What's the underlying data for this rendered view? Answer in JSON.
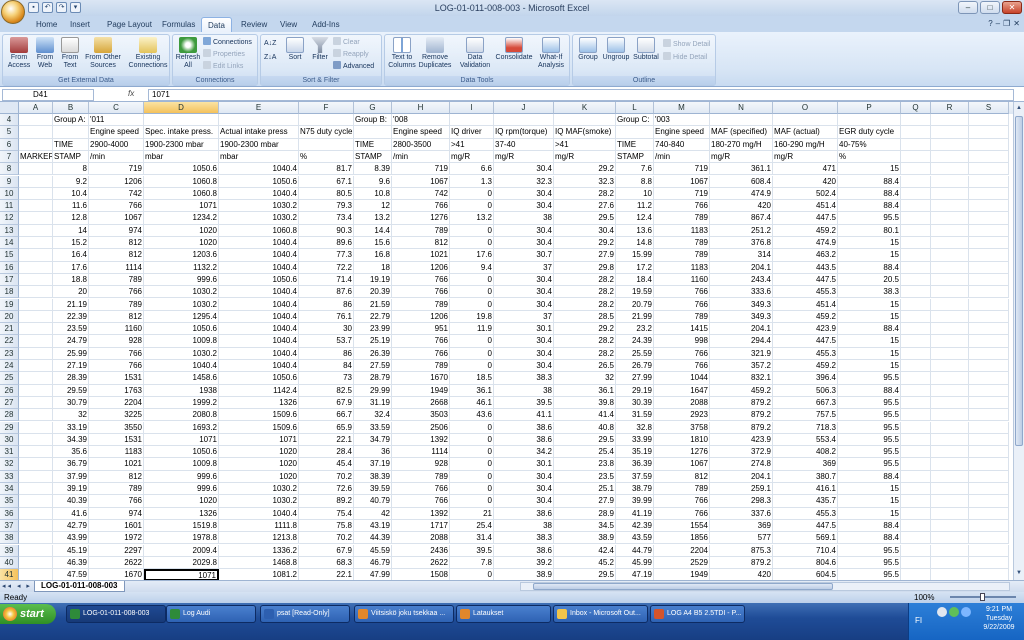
{
  "window": {
    "title": "LOG-01-011-008-003 - Microsoft Excel",
    "minimize": "–",
    "maximize": "□",
    "close": "✕"
  },
  "qat": {
    "save": "▪",
    "undo": "↶",
    "redo": "↷",
    "more": "▾"
  },
  "menu_tabs": [
    "Home",
    "Insert",
    "Page Layout",
    "Formulas",
    "Data",
    "Review",
    "View",
    "Add-Ins"
  ],
  "active_tab": "Data",
  "workbook_controls": {
    "help": "?",
    "minimize": "–",
    "restore": "❐",
    "close": "✕"
  },
  "ribbon": {
    "external": {
      "label": "Get External Data",
      "from_access": "From Access",
      "from_web": "From Web",
      "from_text": "From Text",
      "from_other": "From Other Sources",
      "existing": "Existing Connections"
    },
    "connections": {
      "label": "Connections",
      "refresh": "Refresh All",
      "connections": "Connections",
      "properties": "Properties",
      "edit_links": "Edit Links"
    },
    "sort": {
      "label": "Sort & Filter",
      "az": "A↓Z",
      "za": "Z↓A",
      "sort": "Sort",
      "filter": "Filter",
      "clear": "Clear",
      "reapply": "Reapply",
      "advanced": "Advanced"
    },
    "tools": {
      "label": "Data Tools",
      "text_to_columns": "Text to Columns",
      "remove_duplicates": "Remove Duplicates",
      "validation": "Data Validation",
      "consolidate": "Consolidate",
      "what_if": "What-If Analysis"
    },
    "outline": {
      "label": "Outline",
      "group": "Group",
      "ungroup": "Ungroup",
      "subtotal": "Subtotal",
      "show_detail": "Show Detail",
      "hide_detail": "Hide Detail"
    }
  },
  "formula_bar": {
    "name_box": "D41",
    "fx": "fx",
    "value": "1071"
  },
  "columns": [
    "A",
    "B",
    "C",
    "D",
    "E",
    "F",
    "G",
    "H",
    "I",
    "J",
    "K",
    "L",
    "M",
    "N",
    "O",
    "P",
    "Q",
    "R",
    "S"
  ],
  "rows": [
    {
      "n": "4",
      "c": [
        "",
        "Group A:",
        "'011",
        "",
        "",
        "",
        "Group B:",
        "'008",
        "",
        "",
        "",
        "Group C:",
        "'003",
        "",
        "",
        "",
        "",
        "",
        ""
      ]
    },
    {
      "n": "5",
      "c": [
        "",
        "",
        "Engine speed",
        "Spec. intake press.",
        "Actual intake press",
        "N75 duty cycle",
        "",
        "Engine speed",
        "IQ driver",
        "IQ rpm(torque)",
        "IQ MAF(smoke)",
        "",
        "Engine speed",
        "MAF (specified)",
        "MAF (actual)",
        "EGR duty cycle",
        "",
        "",
        ""
      ]
    },
    {
      "n": "6",
      "c": [
        "",
        "TIME",
        "2900-4000",
        "1900-2300 mbar",
        "1900-2300 mbar",
        "",
        "TIME",
        "2800-3500",
        ">41",
        "37-40",
        ">41",
        "TIME",
        "740-840",
        "180-270 mg/H",
        "160-290 mg/H",
        "40-75%",
        "",
        "",
        ""
      ]
    },
    {
      "n": "7",
      "c": [
        "MARKER",
        "STAMP",
        "/min",
        "mbar",
        "mbar",
        "%",
        "STAMP",
        "/min",
        "mg/R",
        "mg/R",
        "mg/R",
        "STAMP",
        "/min",
        "mg/R",
        "mg/R",
        "%",
        "",
        "",
        ""
      ]
    },
    {
      "n": "8",
      "c": [
        "",
        "8",
        "719",
        "1050.6",
        "1040.4",
        "81.7",
        "8.39",
        "719",
        "6.6",
        "30.4",
        "29.2",
        "7.6",
        "719",
        "361.1",
        "471",
        "15",
        "",
        "",
        ""
      ]
    },
    {
      "n": "9",
      "c": [
        "",
        "9.2",
        "1206",
        "1060.8",
        "1050.6",
        "67.1",
        "9.6",
        "1067",
        "1.3",
        "32.3",
        "32.3",
        "8.8",
        "1067",
        "608.4",
        "420",
        "88.4",
        "",
        "",
        ""
      ]
    },
    {
      "n": "10",
      "c": [
        "",
        "10.4",
        "742",
        "1060.8",
        "1040.4",
        "80.5",
        "10.8",
        "742",
        "0",
        "30.4",
        "28.2",
        "10",
        "719",
        "474.9",
        "502.4",
        "88.4",
        "",
        "",
        ""
      ]
    },
    {
      "n": "11",
      "c": [
        "",
        "11.6",
        "766",
        "1071",
        "1030.2",
        "79.3",
        "12",
        "766",
        "0",
        "30.4",
        "27.6",
        "11.2",
        "766",
        "420",
        "451.4",
        "88.4",
        "",
        "",
        ""
      ]
    },
    {
      "n": "12",
      "c": [
        "",
        "12.8",
        "1067",
        "1234.2",
        "1030.2",
        "73.4",
        "13.2",
        "1276",
        "13.2",
        "38",
        "29.5",
        "12.4",
        "789",
        "867.4",
        "447.5",
        "95.5",
        "",
        "",
        ""
      ]
    },
    {
      "n": "13",
      "c": [
        "",
        "14",
        "974",
        "1020",
        "1060.8",
        "90.3",
        "14.4",
        "789",
        "0",
        "30.4",
        "30.4",
        "13.6",
        "1183",
        "251.2",
        "459.2",
        "80.1",
        "",
        "",
        ""
      ]
    },
    {
      "n": "14",
      "c": [
        "",
        "15.2",
        "812",
        "1020",
        "1040.4",
        "89.6",
        "15.6",
        "812",
        "0",
        "30.4",
        "29.2",
        "14.8",
        "789",
        "376.8",
        "474.9",
        "15",
        "",
        "",
        ""
      ]
    },
    {
      "n": "15",
      "c": [
        "",
        "16.4",
        "812",
        "1203.6",
        "1040.4",
        "77.3",
        "16.8",
        "1021",
        "17.6",
        "30.7",
        "27.9",
        "15.99",
        "789",
        "314",
        "463.2",
        "15",
        "",
        "",
        ""
      ]
    },
    {
      "n": "16",
      "c": [
        "",
        "17.6",
        "1114",
        "1132.2",
        "1040.4",
        "72.2",
        "18",
        "1206",
        "9.4",
        "37",
        "29.8",
        "17.2",
        "1183",
        "204.1",
        "443.5",
        "88.4",
        "",
        "",
        ""
      ]
    },
    {
      "n": "17",
      "c": [
        "",
        "18.8",
        "789",
        "999.6",
        "1050.6",
        "71.4",
        "19.19",
        "766",
        "0",
        "30.4",
        "28.2",
        "18.4",
        "1160",
        "243.4",
        "447.5",
        "20.5",
        "",
        "",
        ""
      ]
    },
    {
      "n": "18",
      "c": [
        "",
        "20",
        "766",
        "1030.2",
        "1040.4",
        "87.6",
        "20.39",
        "766",
        "0",
        "30.4",
        "28.2",
        "19.59",
        "766",
        "333.6",
        "455.3",
        "38.3",
        "",
        "",
        ""
      ]
    },
    {
      "n": "19",
      "c": [
        "",
        "21.19",
        "789",
        "1030.2",
        "1040.4",
        "86",
        "21.59",
        "789",
        "0",
        "30.4",
        "28.2",
        "20.79",
        "766",
        "349.3",
        "451.4",
        "15",
        "",
        "",
        ""
      ]
    },
    {
      "n": "20",
      "c": [
        "",
        "22.39",
        "812",
        "1295.4",
        "1040.4",
        "76.1",
        "22.79",
        "1206",
        "19.8",
        "37",
        "28.5",
        "21.99",
        "789",
        "349.3",
        "459.2",
        "15",
        "",
        "",
        ""
      ]
    },
    {
      "n": "21",
      "c": [
        "",
        "23.59",
        "1160",
        "1050.6",
        "1040.4",
        "30",
        "23.99",
        "951",
        "11.9",
        "30.1",
        "29.2",
        "23.2",
        "1415",
        "204.1",
        "423.9",
        "88.4",
        "",
        "",
        ""
      ]
    },
    {
      "n": "22",
      "c": [
        "",
        "24.79",
        "928",
        "1009.8",
        "1040.4",
        "53.7",
        "25.19",
        "766",
        "0",
        "30.4",
        "28.2",
        "24.39",
        "998",
        "294.4",
        "447.5",
        "15",
        "",
        "",
        ""
      ]
    },
    {
      "n": "23",
      "c": [
        "",
        "25.99",
        "766",
        "1030.2",
        "1040.4",
        "86",
        "26.39",
        "766",
        "0",
        "30.4",
        "28.2",
        "25.59",
        "766",
        "321.9",
        "455.3",
        "15",
        "",
        "",
        ""
      ]
    },
    {
      "n": "24",
      "c": [
        "",
        "27.19",
        "766",
        "1040.4",
        "1040.4",
        "84",
        "27.59",
        "789",
        "0",
        "30.4",
        "26.5",
        "26.79",
        "766",
        "357.2",
        "459.2",
        "15",
        "",
        "",
        ""
      ]
    },
    {
      "n": "25",
      "c": [
        "",
        "28.39",
        "1531",
        "1458.6",
        "1050.6",
        "73",
        "28.79",
        "1670",
        "18.5",
        "38.3",
        "32",
        "27.99",
        "1044",
        "832.1",
        "396.4",
        "95.5",
        "",
        "",
        ""
      ]
    },
    {
      "n": "26",
      "c": [
        "",
        "29.59",
        "1763",
        "1938",
        "1142.4",
        "82.5",
        "29.99",
        "1949",
        "36.1",
        "38",
        "36.1",
        "29.19",
        "1647",
        "459.2",
        "506.3",
        "88.4",
        "",
        "",
        ""
      ]
    },
    {
      "n": "27",
      "c": [
        "",
        "30.79",
        "2204",
        "1999.2",
        "1326",
        "67.9",
        "31.19",
        "2668",
        "46.1",
        "39.5",
        "39.8",
        "30.39",
        "2088",
        "879.2",
        "667.3",
        "95.5",
        "",
        "",
        ""
      ]
    },
    {
      "n": "28",
      "c": [
        "",
        "32",
        "3225",
        "2080.8",
        "1509.6",
        "66.7",
        "32.4",
        "3503",
        "43.6",
        "41.1",
        "41.4",
        "31.59",
        "2923",
        "879.2",
        "757.5",
        "95.5",
        "",
        "",
        ""
      ]
    },
    {
      "n": "29",
      "c": [
        "",
        "33.19",
        "3550",
        "1693.2",
        "1509.6",
        "65.9",
        "33.59",
        "2506",
        "0",
        "38.6",
        "40.8",
        "32.8",
        "3758",
        "879.2",
        "718.3",
        "95.5",
        "",
        "",
        ""
      ]
    },
    {
      "n": "30",
      "c": [
        "",
        "34.39",
        "1531",
        "1071",
        "1071",
        "22.1",
        "34.79",
        "1392",
        "0",
        "38.6",
        "29.5",
        "33.99",
        "1810",
        "423.9",
        "553.4",
        "95.5",
        "",
        "",
        ""
      ]
    },
    {
      "n": "31",
      "c": [
        "",
        "35.6",
        "1183",
        "1050.6",
        "1020",
        "28.4",
        "36",
        "1114",
        "0",
        "34.2",
        "25.4",
        "35.19",
        "1276",
        "372.9",
        "408.2",
        "95.5",
        "",
        "",
        ""
      ]
    },
    {
      "n": "32",
      "c": [
        "",
        "36.79",
        "1021",
        "1009.8",
        "1020",
        "45.4",
        "37.19",
        "928",
        "0",
        "30.1",
        "23.8",
        "36.39",
        "1067",
        "274.8",
        "369",
        "95.5",
        "",
        "",
        ""
      ]
    },
    {
      "n": "33",
      "c": [
        "",
        "37.99",
        "812",
        "999.6",
        "1020",
        "70.2",
        "38.39",
        "789",
        "0",
        "30.4",
        "23.5",
        "37.59",
        "812",
        "204.1",
        "380.7",
        "88.4",
        "",
        "",
        ""
      ]
    },
    {
      "n": "34",
      "c": [
        "",
        "39.19",
        "789",
        "999.6",
        "1030.2",
        "72.6",
        "39.59",
        "766",
        "0",
        "30.4",
        "25.1",
        "38.79",
        "789",
        "259.1",
        "416.1",
        "15",
        "",
        "",
        ""
      ]
    },
    {
      "n": "35",
      "c": [
        "",
        "40.39",
        "766",
        "1020",
        "1030.2",
        "89.2",
        "40.79",
        "766",
        "0",
        "30.4",
        "27.9",
        "39.99",
        "766",
        "298.3",
        "435.7",
        "15",
        "",
        "",
        ""
      ]
    },
    {
      "n": "36",
      "c": [
        "",
        "41.6",
        "974",
        "1326",
        "1040.4",
        "75.4",
        "42",
        "1392",
        "21",
        "38.6",
        "28.9",
        "41.19",
        "766",
        "337.6",
        "455.3",
        "15",
        "",
        "",
        ""
      ]
    },
    {
      "n": "37",
      "c": [
        "",
        "42.79",
        "1601",
        "1519.8",
        "1111.8",
        "75.8",
        "43.19",
        "1717",
        "25.4",
        "38",
        "34.5",
        "42.39",
        "1554",
        "369",
        "447.5",
        "88.4",
        "",
        "",
        ""
      ]
    },
    {
      "n": "38",
      "c": [
        "",
        "43.99",
        "1972",
        "1978.8",
        "1213.8",
        "70.2",
        "44.39",
        "2088",
        "31.4",
        "38.3",
        "38.9",
        "43.59",
        "1856",
        "577",
        "569.1",
        "88.4",
        "",
        "",
        ""
      ]
    },
    {
      "n": "39",
      "c": [
        "",
        "45.19",
        "2297",
        "2009.4",
        "1336.2",
        "67.9",
        "45.59",
        "2436",
        "39.5",
        "38.6",
        "42.4",
        "44.79",
        "2204",
        "875.3",
        "710.4",
        "95.5",
        "",
        "",
        ""
      ]
    },
    {
      "n": "40",
      "c": [
        "",
        "46.39",
        "2622",
        "2029.8",
        "1468.8",
        "68.3",
        "46.79",
        "2622",
        "7.8",
        "39.2",
        "45.2",
        "45.99",
        "2529",
        "879.2",
        "804.6",
        "95.5",
        "",
        "",
        ""
      ]
    },
    {
      "n": "41",
      "c": [
        "",
        "47.59",
        "1670",
        "1071",
        "1081.2",
        "22.1",
        "47.99",
        "1508",
        "0",
        "38.9",
        "29.5",
        "47.19",
        "1949",
        "420",
        "604.5",
        "95.5",
        "",
        "",
        ""
      ]
    }
  ],
  "sheet_nav": "◂◂ ◂ ▸ ▸▸",
  "sheet_tab": "LOG-01-011-008-003",
  "status": {
    "text": "Ready",
    "zoom": "100%"
  },
  "taskbar": {
    "start": "start",
    "items": [
      "LOG-01-011-008-003",
      "Log Audi",
      "psat [Read-Only]",
      "Viitsiskö joku tsekkaa ...",
      "Lataukset",
      "Inbox - Microsoft Out...",
      "LOG A4 B5 2.5TDI - P..."
    ],
    "lang": "FI",
    "time": "9:21 PM",
    "day": "Tuesday",
    "date": "9/22/2009"
  },
  "colors": {
    "accent": "#f4c15b",
    "ribbon": "#d7e5f5",
    "taskbar": "#1f4c97"
  }
}
